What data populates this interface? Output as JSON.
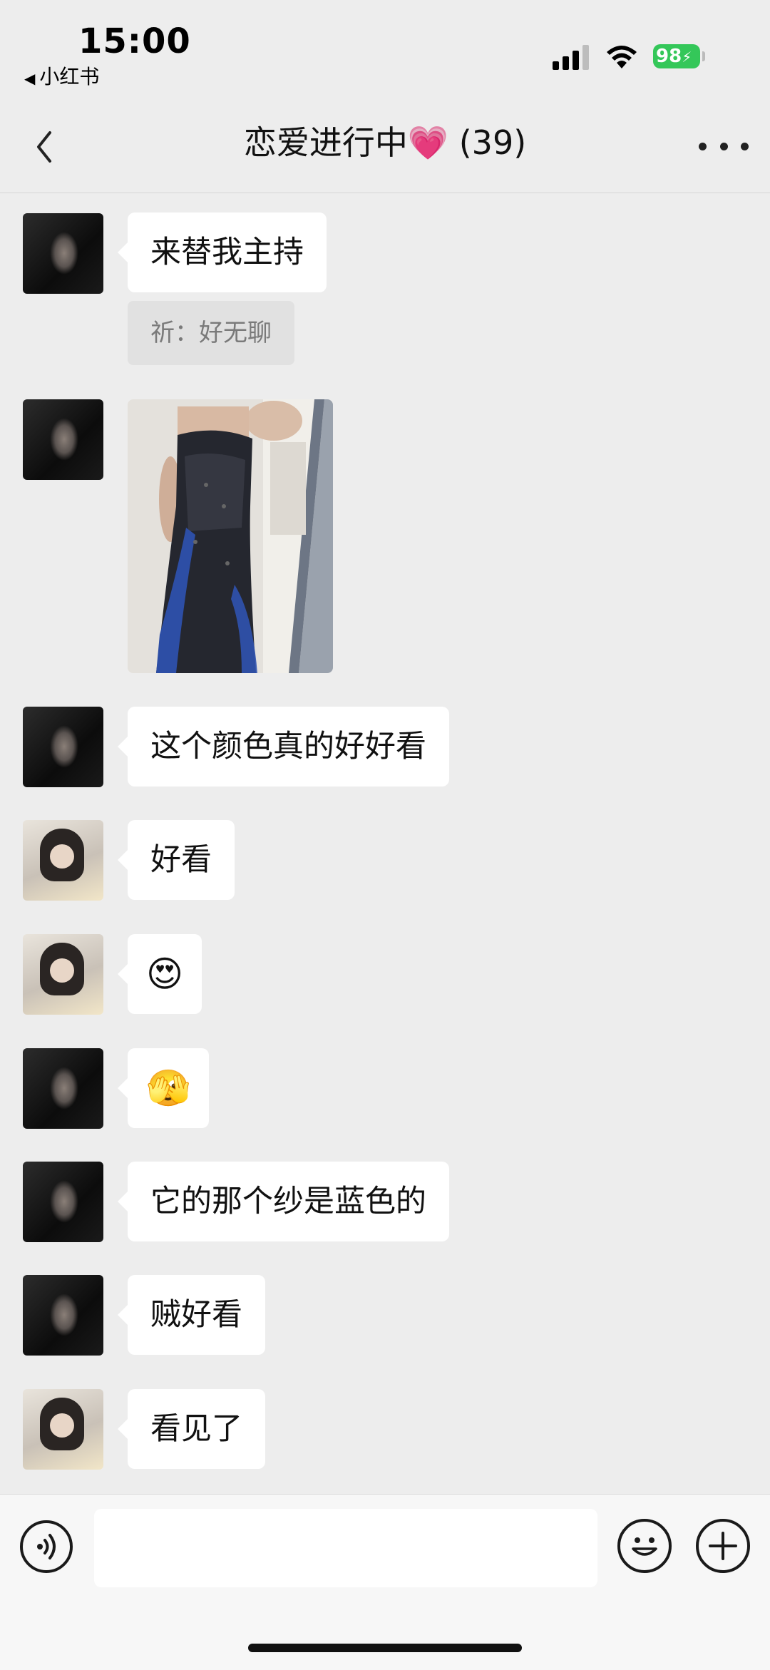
{
  "status_bar": {
    "time": "15:00",
    "back_app": "小红书",
    "battery": "98"
  },
  "nav": {
    "title": "恋爱进行中",
    "title_emoji": "💗",
    "member_count": "(39)"
  },
  "messages": [
    {
      "text": "来替我主持",
      "quote": "祈：好无聊"
    },
    {
      "image": "dress-photo"
    },
    {
      "text": "这个颜色真的好好看"
    },
    {
      "text": "好看"
    },
    {
      "text": "😍"
    },
    {
      "text": "🫣"
    },
    {
      "text": "它的那个纱是蓝色的"
    },
    {
      "text": "贼好看"
    },
    {
      "text": "看见了"
    }
  ],
  "input_bar": {
    "placeholder": ""
  },
  "colors": {
    "background": "#ededed",
    "bubble": "#ffffff",
    "quote": "#e1e1e1",
    "battery": "#34c759"
  }
}
